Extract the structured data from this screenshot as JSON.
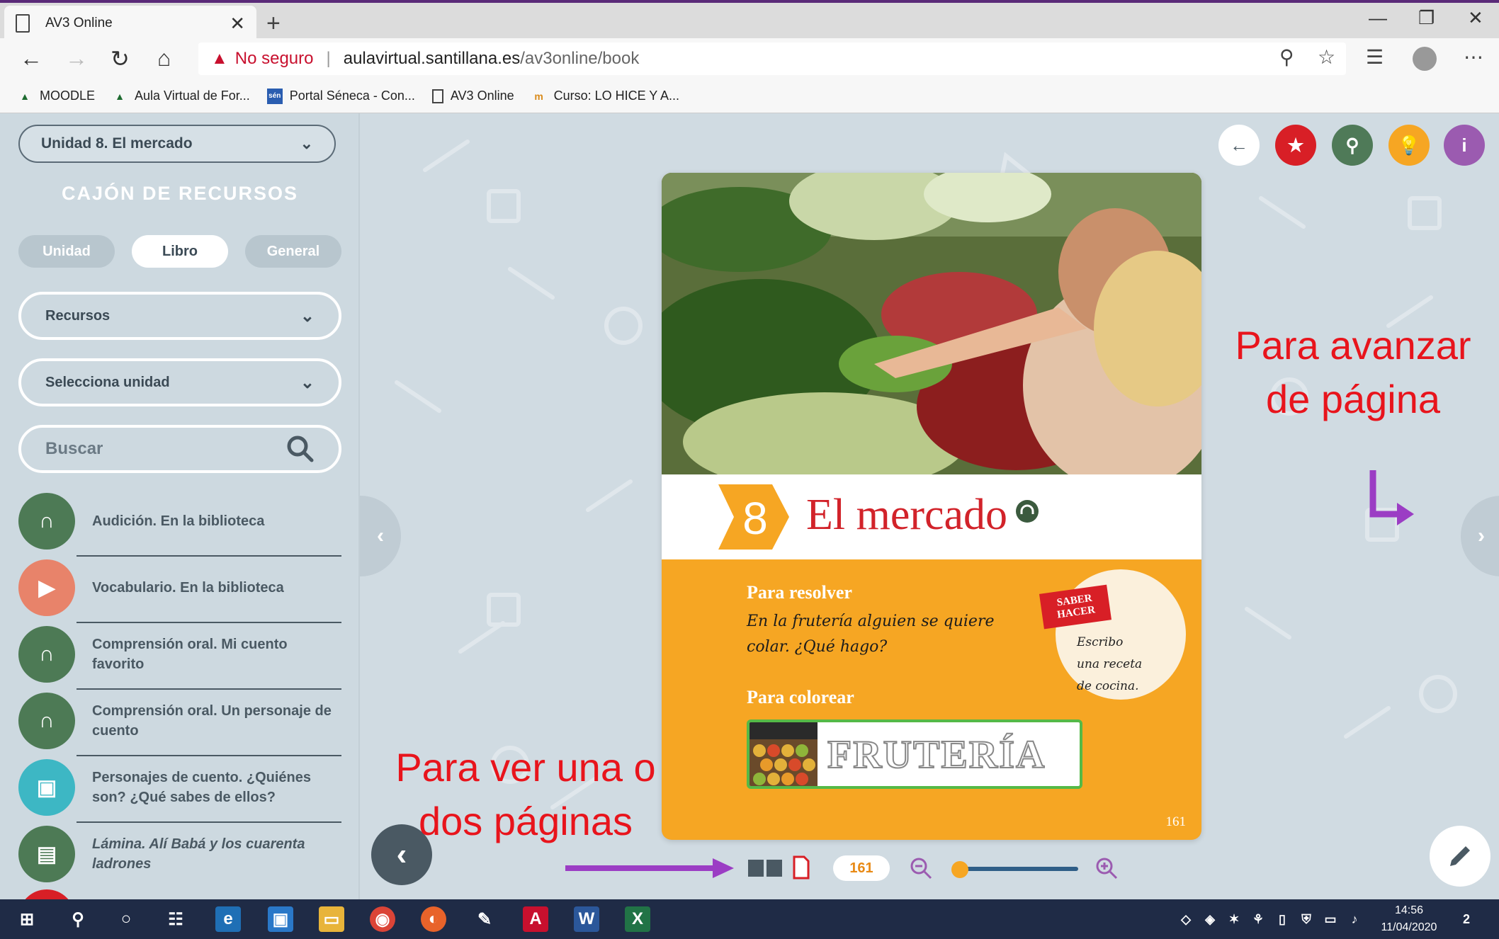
{
  "browser": {
    "tab_title": "AV3 Online",
    "tab_close": "✕",
    "new_tab": "+",
    "url_warning": "No seguro",
    "url_separator": "|",
    "url_host": "aulavirtual.santillana.es",
    "url_path": "/av3online/book",
    "bookmarks": [
      {
        "label": "MOODLE",
        "icon": "moodle-icon",
        "color": "#1e6b30"
      },
      {
        "label": "Aula Virtual de For...",
        "icon": "moodle-icon",
        "color": "#1e6b30"
      },
      {
        "label": "Portal Séneca - Con...",
        "icon": "seneca-icon",
        "color": "#2a5db0"
      },
      {
        "label": "AV3 Online",
        "icon": "page-icon",
        "color": "#444444"
      },
      {
        "label": "Curso: LO HICE Y A...",
        "icon": "course-icon",
        "color": "#d98a1a"
      }
    ]
  },
  "sidebar": {
    "unit_select": "Unidad 8. El mercado",
    "title": "CAJÓN DE RECURSOS",
    "segments": [
      "Unidad",
      "Libro",
      "General"
    ],
    "active_segment": "Libro",
    "filter_resources": "Recursos",
    "filter_unit": "Selecciona unidad",
    "search_placeholder": "Buscar",
    "resources": [
      {
        "label": "Audición. En la biblioteca",
        "icon": "headphones-icon",
        "color": "#4d7a55"
      },
      {
        "label": "Vocabulario. En la biblioteca",
        "icon": "video-icon",
        "color": "#e8836a"
      },
      {
        "label": "Comprensión oral. Mi cuento favorito",
        "icon": "headphones-icon",
        "color": "#4d7a55"
      },
      {
        "label": "Comprensión oral. Un personaje de cuento",
        "icon": "headphones-icon",
        "color": "#4d7a55"
      },
      {
        "label": "Personajes de cuento. ¿Quiénes son? ¿Qué sabes de ellos?",
        "icon": "image-icon",
        "color": "#3db7c4"
      },
      {
        "label": "Lámina. Alí Babá y los cuarenta ladrones",
        "icon": "document-icon",
        "color": "#4d7a55"
      }
    ]
  },
  "toolbar": {
    "buttons": [
      {
        "name": "back-button",
        "icon": "arrow-left-icon",
        "color": "#ffffff"
      },
      {
        "name": "favorites-button",
        "icon": "star-icon",
        "color": "#d81f26"
      },
      {
        "name": "search-button",
        "icon": "search-icon",
        "color": "#4f7a58"
      },
      {
        "name": "hint-button",
        "icon": "bulb-icon",
        "color": "#f6a623"
      },
      {
        "name": "info-button",
        "icon": "info-icon",
        "color": "#9b5bb0"
      }
    ]
  },
  "book": {
    "unit_number": "8",
    "title": "El mercado",
    "section_resolve": "Para resolver",
    "resolve_text_1": "En la frutería alguien se quiere",
    "resolve_text_2": "colar. ¿Qué hago?",
    "section_color": "Para colorear",
    "saber_tag_1": "SABER",
    "saber_tag_2": "HACER",
    "saber_text_1": "Escribo",
    "saber_text_2": "una receta",
    "saber_text_3": "de cocina.",
    "fruteria_word": "FRUTERÍA",
    "page_label": "161"
  },
  "viewer": {
    "current_page": "161",
    "zoom_level": 0.05
  },
  "annotations": {
    "advance_1": "Para avanzar",
    "advance_2": "de página",
    "view_1": "Para ver una o",
    "view_2": "dos páginas",
    "color": "#e8141c"
  },
  "taskbar": {
    "time": "14:56",
    "date": "11/04/2020",
    "notifications": "2"
  }
}
